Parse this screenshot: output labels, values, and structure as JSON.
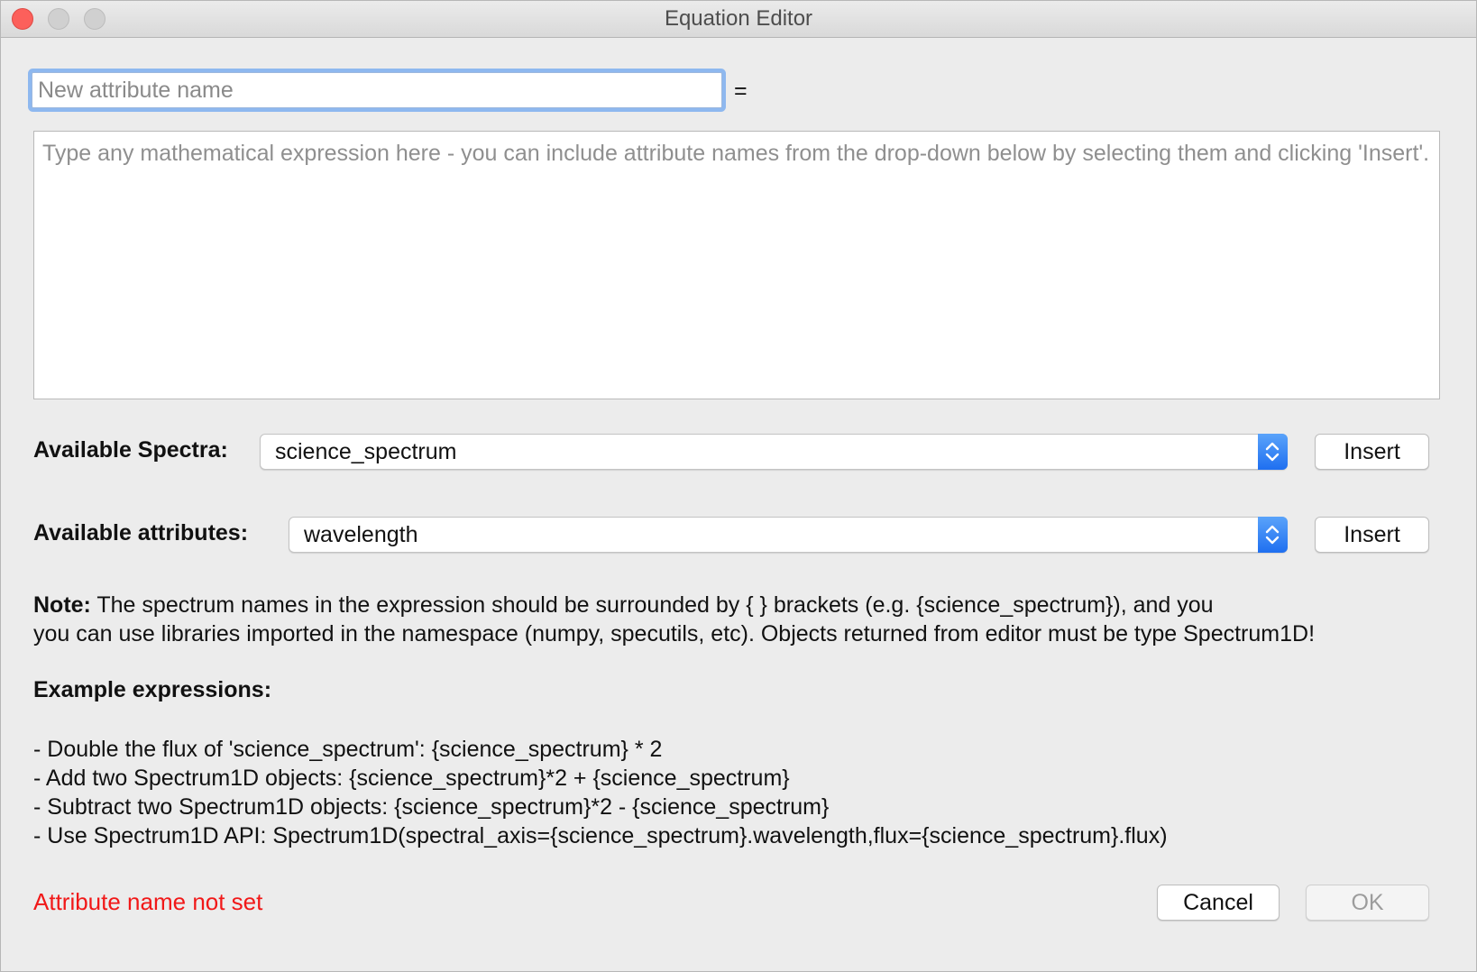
{
  "window": {
    "title": "Equation Editor"
  },
  "attribute_name": {
    "placeholder": "New attribute name",
    "value": "",
    "equals": "="
  },
  "expression": {
    "placeholder": "Type any mathematical expression here - you can include attribute names from the drop-down below by selecting them and clicking 'Insert'.",
    "value": ""
  },
  "spectra_row": {
    "label": "Available Spectra:",
    "selected": "science_spectrum",
    "insert_label": "Insert"
  },
  "attributes_row": {
    "label": "Available attributes:",
    "selected": "wavelength",
    "insert_label": "Insert"
  },
  "note": {
    "lead": "Note:",
    "line1": " The spectrum names in the expression should be surrounded by { } brackets (e.g. {science_spectrum}), and you",
    "line2": "you can use libraries imported in the namespace (numpy, specutils, etc). Objects returned from editor must be type Spectrum1D!"
  },
  "examples": {
    "title": "Example expressions:",
    "items": [
      "- Double the flux of 'science_spectrum': {science_spectrum} * 2",
      "- Add two Spectrum1D objects: {science_spectrum}*2 + {science_spectrum}",
      "- Subtract two Spectrum1D objects: {science_spectrum}*2 - {science_spectrum}",
      "- Use Spectrum1D API: Spectrum1D(spectral_axis={science_spectrum}.wavelength,flux={science_spectrum}.flux)"
    ]
  },
  "status": {
    "message": "Attribute name not set",
    "color": "#f11818"
  },
  "buttons": {
    "cancel": "Cancel",
    "ok": "OK"
  },
  "colors": {
    "close_button": "#fc605b",
    "focus_ring": "#8eb8ef",
    "combo_accent": "#1f6ff0"
  },
  "icons": {
    "combo_arrows": "up-down-chevron-icon"
  }
}
